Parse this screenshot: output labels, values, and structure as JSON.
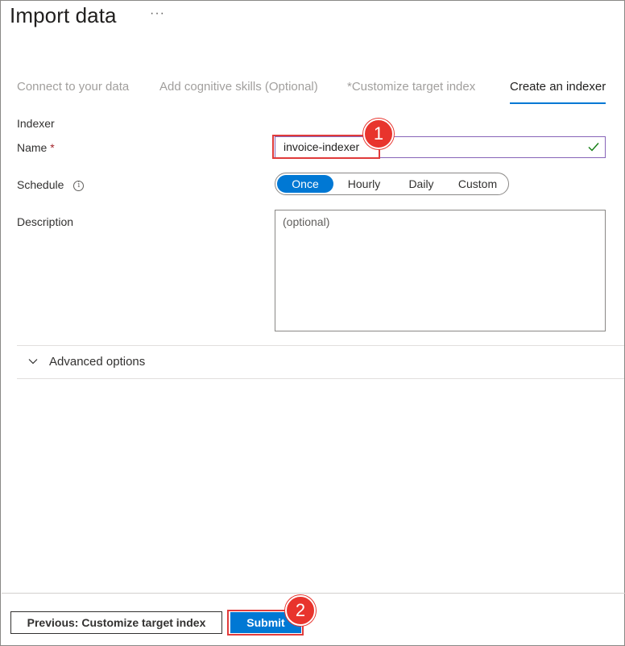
{
  "header": {
    "title": "Import data",
    "more_label": "···"
  },
  "tabs": [
    {
      "label": "Connect to your data"
    },
    {
      "label": "Add cognitive skills (Optional)"
    },
    {
      "label": "*Customize target index"
    },
    {
      "label": "Create an indexer"
    }
  ],
  "form": {
    "section": "Indexer",
    "name_label": "Name",
    "required_mark": "*",
    "name_value": "invoice-indexer",
    "schedule_label": "Schedule",
    "info_icon_glyph": "i",
    "schedule_options": [
      "Once",
      "Hourly",
      "Daily",
      "Custom"
    ],
    "schedule_selected": "Once",
    "description_label": "Description",
    "description_placeholder": "(optional)"
  },
  "advanced": {
    "label": "Advanced options"
  },
  "footer": {
    "previous_label": "Previous: Customize target index",
    "submit_label": "Submit"
  },
  "annotations": {
    "badge1": "1",
    "badge2": "2"
  },
  "colors": {
    "accent": "#0078d4",
    "callout": "#e8342d",
    "valid": "#107c10",
    "focus_border": "#8764b8"
  }
}
